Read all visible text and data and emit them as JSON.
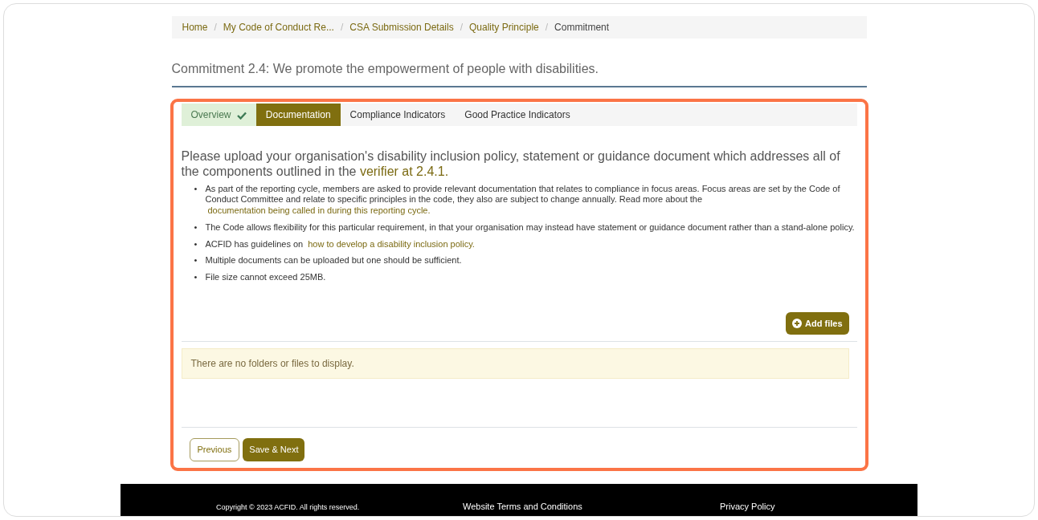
{
  "breadcrumb": [
    {
      "label": "Home",
      "current": false
    },
    {
      "label": "My Code of Conduct Re...",
      "current": false
    },
    {
      "label": "CSA Submission Details",
      "current": false
    },
    {
      "label": "Quality Principle",
      "current": false
    },
    {
      "label": "Commitment",
      "current": true
    }
  ],
  "breadcrumb_separator": "/",
  "bullet_marker": "•",
  "page_title": "Commitment 2.4: We promote the empowerment of people with disabilities.",
  "tabs": [
    {
      "label": "Overview",
      "selected": false,
      "completed": true
    },
    {
      "label": "Documentation",
      "selected": true,
      "completed": false
    },
    {
      "label": "Compliance Indicators",
      "selected": false,
      "completed": false
    },
    {
      "label": "Good Practice Indicators",
      "selected": false,
      "completed": false
    }
  ],
  "heading": {
    "text": "Please upload your organisation's disability inclusion policy, statement or guidance document which addresses all of the components outlined in the",
    "link": "verifier at 2.4.1."
  },
  "bullets": [
    {
      "text": "As part of the reporting cycle, members are asked to provide relevant documentation that relates to compliance in focus areas. Focus areas are set by the Code of Conduct Committee and relate to specific principles in the code, they also are subject to change annually. Read more about the",
      "link": "documentation being called in during this reporting cycle."
    },
    {
      "text": "The Code allows flexibility for this particular requirement, in that your organisation may instead have statement or guidance document rather than a stand-alone policy."
    },
    {
      "text": "ACFID has guidelines on",
      "link": "how to develop a disability inclusion policy."
    },
    {
      "text": "Multiple documents can be uploaded but one should be sufficient."
    },
    {
      "text": "File size cannot exceed 25MB."
    }
  ],
  "add_button": "Add files",
  "empty_message": "There are no folders or files to display.",
  "nav_buttons": [
    {
      "label": "Previous",
      "kind": "outline"
    },
    {
      "label": "Save & Next",
      "kind": "primary"
    }
  ],
  "footer": {
    "copyright": "Copyright © 2023 ACFID. All rights reserved.",
    "links": [
      "Website Terms and Conditions",
      "Privacy Policy"
    ]
  }
}
